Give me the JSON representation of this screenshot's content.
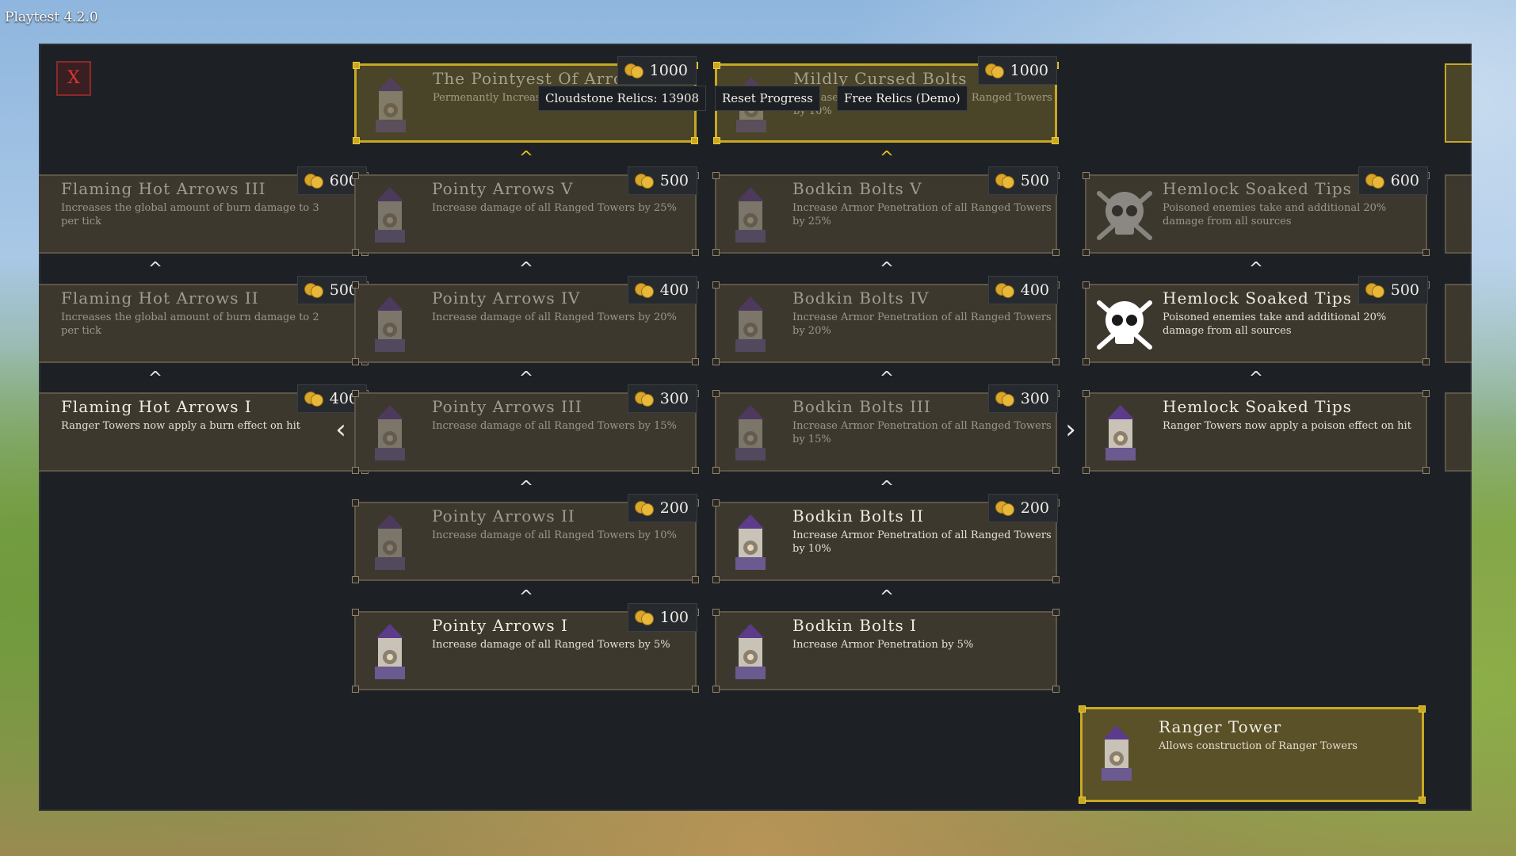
{
  "version": "Playtest 4.2.0",
  "close_label": "X",
  "tooltips": {
    "relics": "Cloudstone Relics: 13908",
    "reset": "Reset Progress",
    "free": "Free Relics (Demo)"
  },
  "columns": {
    "flaming": [
      {
        "title": "Flaming Hot Arrows III",
        "desc": "Increases the global amount of burn damage to 3 per tick",
        "cost": "600"
      },
      {
        "title": "Flaming Hot Arrows II",
        "desc": "Increases the global amount of burn damage to 2 per tick",
        "cost": "500"
      },
      {
        "title": "Flaming Hot Arrows I",
        "desc": "Ranger Towers now apply a burn effect on hit",
        "cost": "400"
      }
    ],
    "pointy": [
      {
        "title": "The Pointyest Of Arrows",
        "desc": "Permenantly Increase Ranged Towers by 10%",
        "cost": "1000"
      },
      {
        "title": "Pointy Arrows V",
        "desc": "Increase damage of all Ranged Towers by 25%",
        "cost": "500"
      },
      {
        "title": "Pointy Arrows IV",
        "desc": "Increase damage of all Ranged Towers by 20%",
        "cost": "400"
      },
      {
        "title": "Pointy Arrows III",
        "desc": "Increase damage of all Ranged Towers by 15%",
        "cost": "300"
      },
      {
        "title": "Pointy Arrows II",
        "desc": "Increase damage of all Ranged Towers by 10%",
        "cost": "200"
      },
      {
        "title": "Pointy Arrows I",
        "desc": "Increase damage of all Ranged Towers by 5%",
        "cost": "100"
      }
    ],
    "bodkin": [
      {
        "title": "Mildly Cursed Bolts",
        "desc": "Increase Armor Penetration of all Ranged Towers by 10%",
        "cost": "1000"
      },
      {
        "title": "Bodkin Bolts V",
        "desc": "Increase Armor Penetration of all Ranged Towers by 25%",
        "cost": "500"
      },
      {
        "title": "Bodkin Bolts IV",
        "desc": "Increase Armor Penetration of all Ranged Towers by 20%",
        "cost": "400"
      },
      {
        "title": "Bodkin Bolts III",
        "desc": "Increase Armor Penetration of all Ranged Towers by 15%",
        "cost": "300"
      },
      {
        "title": "Bodkin Bolts II",
        "desc": "Increase Armor Penetration of all Ranged Towers by 10%",
        "cost": "200"
      },
      {
        "title": "Bodkin Bolts I",
        "desc": "Increase Armor Penetration by 5%"
      }
    ],
    "hemlock": [
      {
        "title": "Hemlock Soaked Tips III",
        "desc": "Poisoned enemies take and additional 20% damage from all sources",
        "cost": "600"
      },
      {
        "title": "Hemlock Soaked Tips II",
        "desc": "Poisoned enemies take and additional 20% damage from all sources",
        "cost": "500"
      },
      {
        "title": "Hemlock Soaked Tips",
        "desc": "Ranger Towers now apply a poison effect on hit"
      }
    ]
  },
  "base": {
    "title": "Ranger Tower",
    "desc": "Allows construction of Ranger Towers"
  },
  "nav": {
    "prev": "‹",
    "next": "›"
  },
  "colors": {
    "gold_accent": "#c8a824",
    "panel_bg": "#1d2125",
    "card_bg": "#3d382e"
  }
}
